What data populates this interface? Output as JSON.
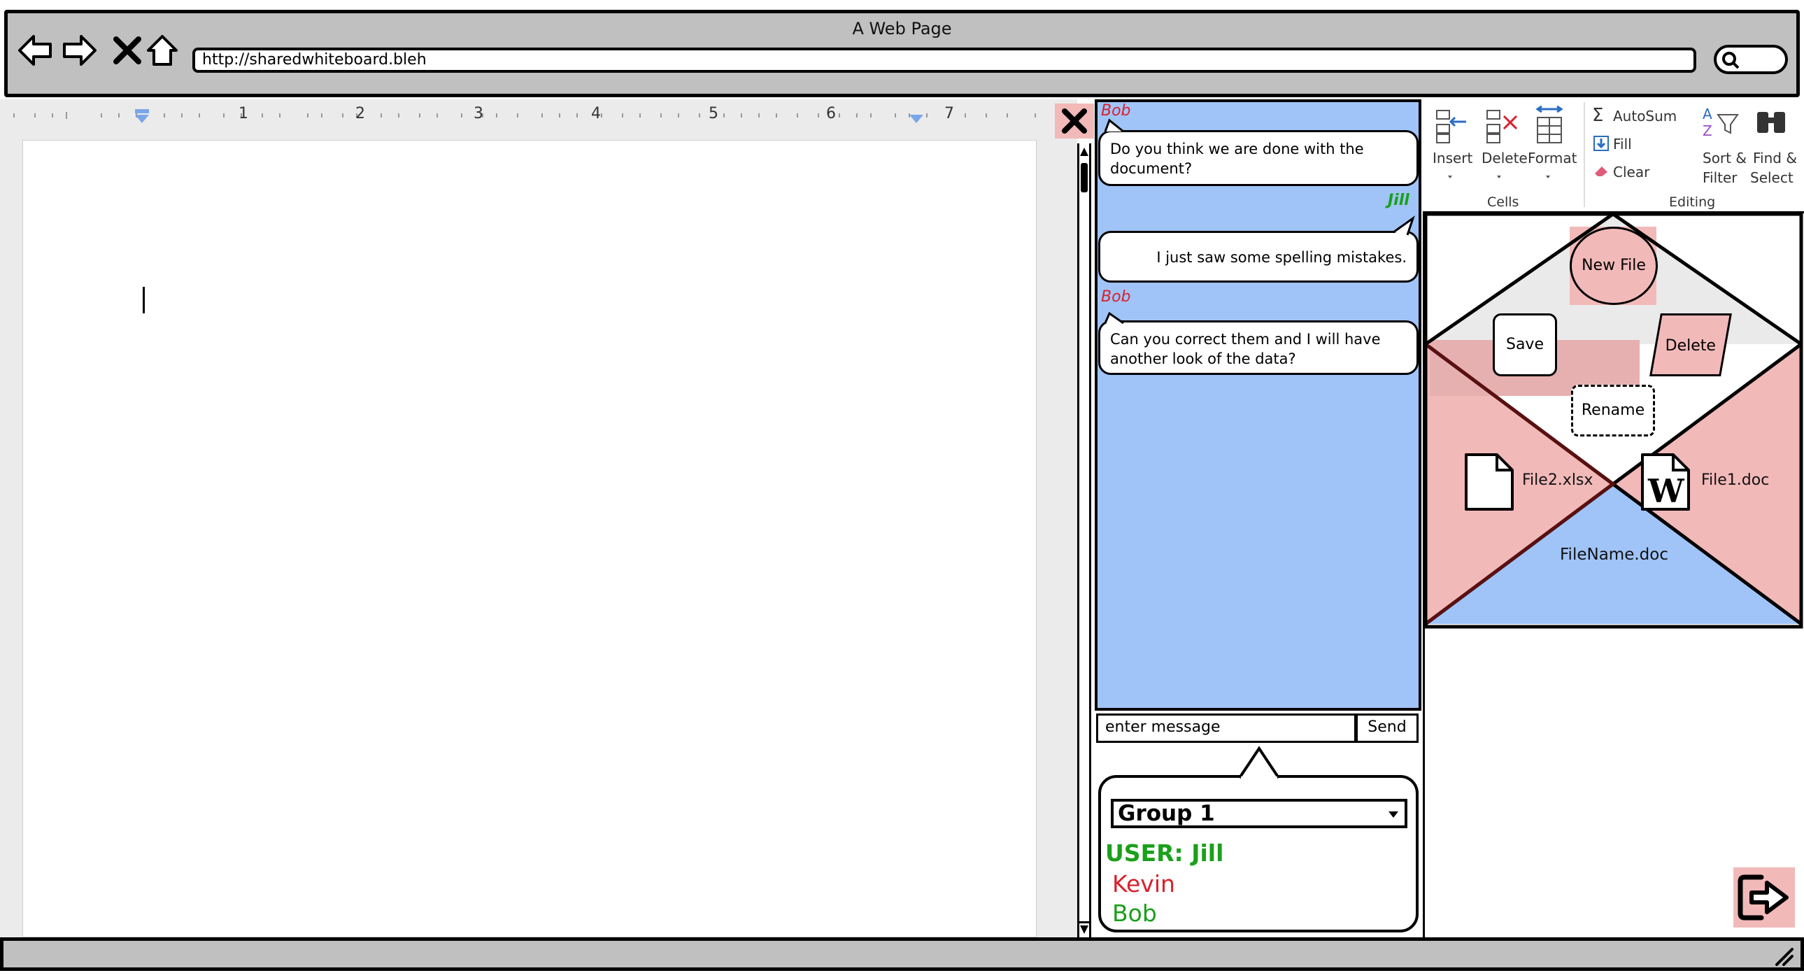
{
  "window": {
    "title": "A Web Page",
    "url": "http://sharedwhiteboard.bleh"
  },
  "ruler": {
    "numbers": [
      "1",
      "2",
      "3",
      "4",
      "5",
      "6",
      "7"
    ]
  },
  "chat": {
    "messages": [
      {
        "author": "Bob",
        "text": "Do you think we are done with the document?",
        "color": "#d9202b"
      },
      {
        "author": "Jill",
        "text": "I just saw some spelling mistakes.",
        "color": "#1aa01a"
      },
      {
        "author": "Bob",
        "text": "Can you correct them and I will have another look of the data?",
        "color": "#d9202b"
      }
    ],
    "input_value": "enter message",
    "send_label": "Send"
  },
  "group": {
    "selected": "Group 1",
    "current_user": "USER: Jill",
    "members": [
      {
        "name": "Kevin",
        "color": "#d9202b"
      },
      {
        "name": "Bob",
        "color": "#1aa01a"
      }
    ]
  },
  "ribbon": {
    "insert": "Insert",
    "delete": "Delete",
    "format": "Format",
    "cells_group": "Cells",
    "autosum": "AutoSum",
    "fill": "Fill",
    "clear": "Clear",
    "sort_line1": "Sort &",
    "sort_line2": "Filter",
    "find_line1": "Find &",
    "find_line2": "Select",
    "editing_group": "Editing"
  },
  "files": {
    "new_file": "New File",
    "save": "Save",
    "delete": "Delete",
    "rename": "Rename",
    "file2": "File2.xlsx",
    "file1": "File1.doc",
    "filename": "FileName.doc"
  },
  "colors": {
    "accent_pink": "#f2b9b9",
    "chat_blue": "#a0c4f8",
    "bob_red": "#d9202b",
    "jill_green": "#1aa01a"
  },
  "icons": [
    "back-arrow-icon",
    "forward-arrow-icon",
    "close-x-icon",
    "home-icon",
    "search-icon",
    "document-icon",
    "word-icon",
    "exit-icon",
    "resize-grip-icon"
  ]
}
